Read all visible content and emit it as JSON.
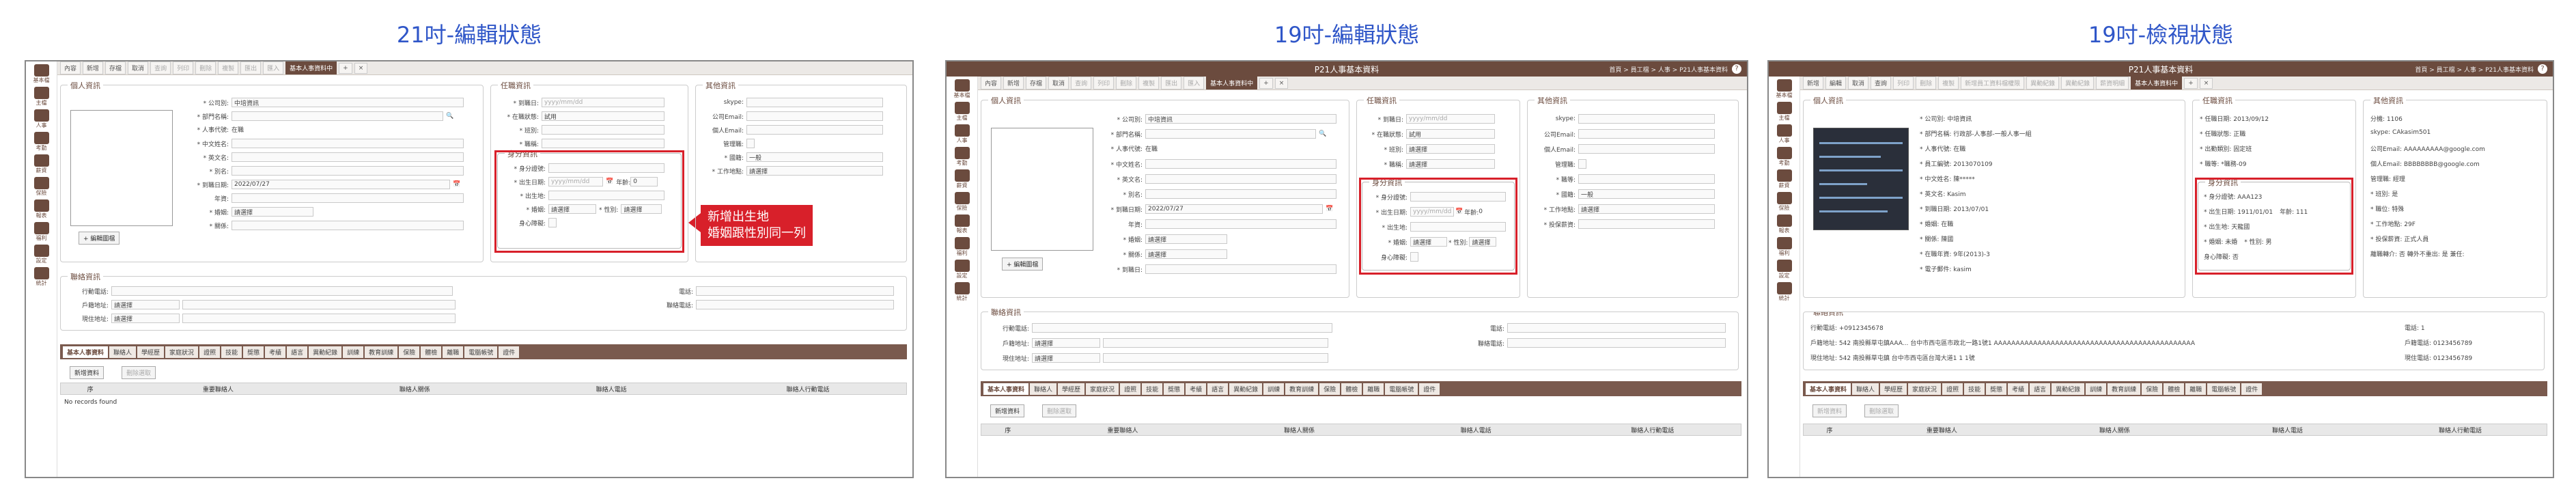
{
  "captions": [
    "21吋-編輯狀態",
    "19吋-編輯狀態",
    "19吋-檢視狀態"
  ],
  "app_title": "P21人事基本資料",
  "titlebar_right": "首頁 > 員工檔 > 人事 > P21人事基本資料",
  "toolbar": {
    "panel1": [
      "內容",
      "新增",
      "存檔",
      "取消",
      "查詢",
      "列印",
      "刪除",
      "複製",
      "匯出",
      "匯入",
      "基本人事資料中",
      "+",
      "×"
    ],
    "panel2": [
      "內容",
      "新增",
      "存檔",
      "取消",
      "查詢",
      "列印",
      "刪除",
      "複製",
      "匯出",
      "匯入",
      "基本人事資料中",
      "+",
      "×"
    ],
    "panel3": [
      "新增",
      "編輯",
      "取消",
      "查詢",
      "列印",
      "刪除",
      "複製",
      "新增員工資料檔權限",
      "異動紀錄",
      "異動紀錄",
      "薪資明細",
      "基本人事資料中",
      "+",
      "×"
    ]
  },
  "sidebar_items": [
    "基本檔",
    "主檔",
    "人事",
    "考勤",
    "薪資",
    "保險",
    "報表",
    "福利",
    "設定",
    "統計"
  ],
  "sections": {
    "personal": "個人資訊",
    "employment": "任職資訊",
    "other": "其他資訊",
    "identity": "身分資訊",
    "contact": "聯絡資訊"
  },
  "edit_fields": {
    "company_label": "* 公司別:",
    "company_value": "中培資訊",
    "dept_label": "* 部門名稱:",
    "emp_no_label": "* 人事代號:",
    "emp_no_value": "在職",
    "name_label": "* 中文姓名:",
    "eng_label": "* 英文名:",
    "alias_label": "* 別名:",
    "birth_label": "* 到職日期:",
    "birth_value": "2022/07/27",
    "age_label": "年資:",
    "marital_label": "* 婚姻:",
    "marital_value": "請選擇",
    "relation_label": "* 關係:",
    "enter_label": "* 到職日:",
    "period_label": "* 在職狀態:",
    "hire_date_placeholder": "yyyy/mm/dd",
    "status_value": "試用",
    "id_label": "* 身分證號:",
    "dob_label": "* 出生日期:",
    "dob_placeholder": "yyyy/mm/dd",
    "age_field_label": "年齡:",
    "age_field_value": "0",
    "birthplace_label": "* 出生地:",
    "marriage_label": "* 婚姻:",
    "gender_label": "* 性別:",
    "marriage_value": "請選擇",
    "military_label": "身心障礙:",
    "add_photo_button": "+ 編輯圖檔",
    "mobile_label": "行動電話:",
    "residence_label": "戶籍地址:",
    "address_label": "現住地址:",
    "phone_label": "電話:",
    "phone2_label": "聯絡電話:",
    "select_placeholder": "請選擇",
    "nation_label": "* 國籍:",
    "nation_value": "一般",
    "work_label": "* 工作地點:",
    "skype_label": "skype:",
    "email_label": "公司Email:",
    "personal_email_label": "個人Email:",
    "manager_label": "管理職:",
    "shift_label": "* 班別:",
    "level_label": "* 職等:",
    "title_label": "* 職稱:",
    "insurance_label": "* 投保薪資:"
  },
  "callout": "新增出生地\n婚姻跟性別同一列",
  "tabs": [
    "基本人事資料",
    "聯絡人",
    "學經歷",
    "家庭狀況",
    "證照",
    "技能",
    "獎懲",
    "考績",
    "語言",
    "異動紀錄",
    "訓練",
    "教育訓練",
    "保險",
    "體檢",
    "離職",
    "電腦帳號",
    "證件"
  ],
  "tab_buttons": [
    "新增資料",
    "刪除選取"
  ],
  "grid_columns": [
    "序",
    "重要聯絡人",
    "聯絡人關係",
    "聯絡人電話",
    "聯絡人行動電話"
  ],
  "empty_text": "No records found",
  "view_fields": {
    "company": "* 公司別: 中培資訊",
    "dept": "* 部門名稱: 行政部-人事部-一般人事一組",
    "emp_no": "* 人事代號: 在職",
    "emp_id": "* 員工編號: 2013070109",
    "name": "* 中文姓名: 陳*****",
    "eng": "* 英文名: Kasim",
    "enter": "* 到職日期: 2013/07/01",
    "marital": "* 婚姻: 在職",
    "relation": "* 關係: 陳國",
    "period": "* 在職年資: 9年(2013)-3",
    "mail": "* 電子郵件: kasim",
    "hire_date": "* 任職日期: 2013/09/12",
    "status": "* 任職狀態: 正職",
    "change": "* 出勤類別: 固定班",
    "grade": "* 職等: *職務-09",
    "id": "* 身分證號: AAA123",
    "dob": "* 出生日期: 1911/01/01",
    "age": "年齡: 111",
    "birthplace": "* 出生地: 天龍國",
    "marriage": "* 婚姻: 未婚",
    "gender": "* 性別: 男",
    "disability": "身心障礙: 否",
    "ext": "分機: 1106",
    "skype": "skype: CAkasim501",
    "company_email": "公司Email: AAAAAAAAA@google.com",
    "personal_email": "個人Email: BBBBBBBB@google.com",
    "manager": "管理職: 經理",
    "shift": "* 班別: 是",
    "level": "* 職位: 特殊",
    "work": "* 工作地點: 29F",
    "insurance": "* 投保薪資: 正式人員",
    "flags": "離職轉介: 否  轉外不重出: 是  兼任:",
    "mobile": "行動電話: +0912345678",
    "residence": "戶籍地址: 542 南投縣草屯鎮AAA... 台中市西屯區市政北一路1號1 AAAAAAAAAAAAAAAAAAAAAAAAAAAAAAAAAAAAAAAAAAAAAA",
    "address": "現住地址: 542 南投縣草屯鎮 台中市西屯區台灣大道1 1 1號",
    "phone": "電話: 1",
    "phone2": "戶籍電話: 0123456789",
    "phone3": "現住電話: 0123456789"
  }
}
